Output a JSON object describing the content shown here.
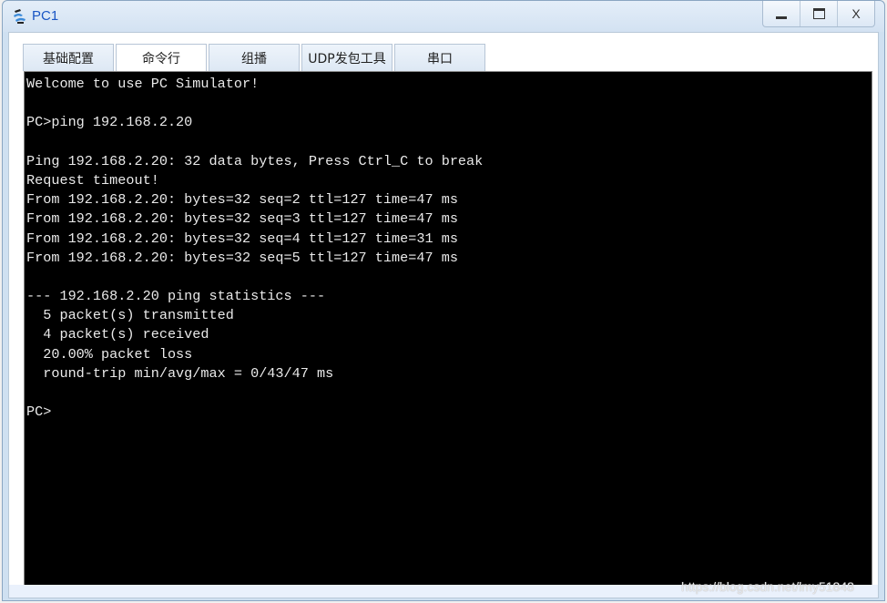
{
  "window": {
    "title": "PC1",
    "controls": {
      "minimize": "_",
      "maximize": "□",
      "close": "X"
    }
  },
  "tabs": [
    {
      "label": "基础配置",
      "active": false
    },
    {
      "label": "命令行",
      "active": true
    },
    {
      "label": "组播",
      "active": false
    },
    {
      "label": "UDP发包工具",
      "active": false
    },
    {
      "label": "串口",
      "active": false
    }
  ],
  "terminal": {
    "lines": [
      "Welcome to use PC Simulator!",
      "",
      "PC>ping 192.168.2.20",
      "",
      "Ping 192.168.2.20: 32 data bytes, Press Ctrl_C to break",
      "Request timeout!",
      "From 192.168.2.20: bytes=32 seq=2 ttl=127 time=47 ms",
      "From 192.168.2.20: bytes=32 seq=3 ttl=127 time=47 ms",
      "From 192.168.2.20: bytes=32 seq=4 ttl=127 time=31 ms",
      "From 192.168.2.20: bytes=32 seq=5 ttl=127 time=47 ms",
      "",
      "--- 192.168.2.20 ping statistics ---",
      "  5 packet(s) transmitted",
      "  4 packet(s) received",
      "  20.00% packet loss",
      "  round-trip min/avg/max = 0/43/47 ms",
      "",
      "PC>"
    ]
  },
  "watermark": "https://blog.csdn.net/lmy51848"
}
